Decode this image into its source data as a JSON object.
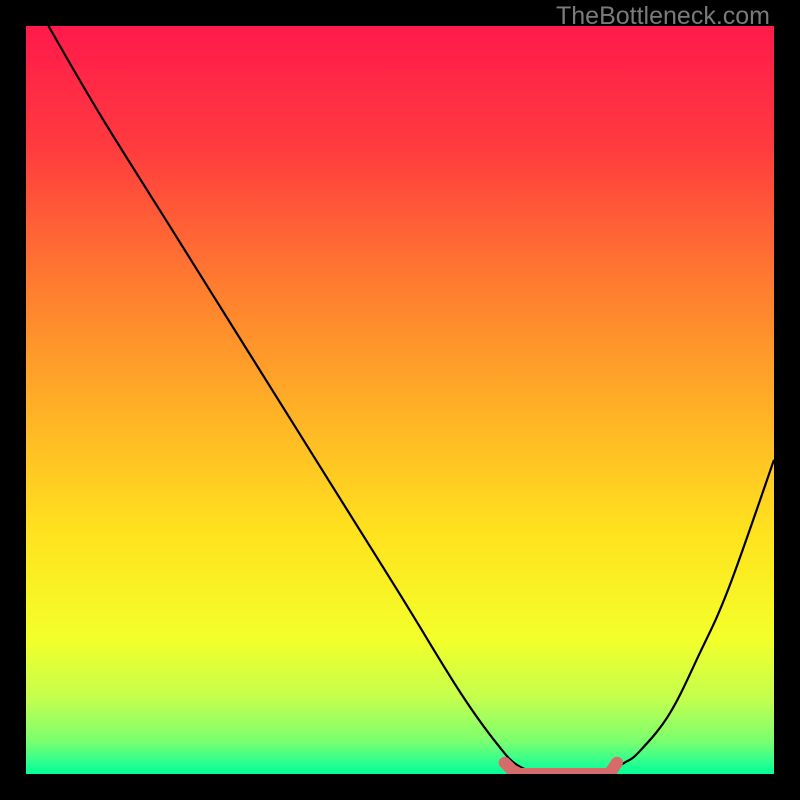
{
  "watermark": "TheBottleneck.com",
  "chart_data": {
    "type": "line",
    "title": "",
    "xlabel": "",
    "ylabel": "",
    "xlim": [
      0,
      100
    ],
    "ylim": [
      0,
      100
    ],
    "grid": false,
    "legend": false,
    "series": [
      {
        "name": "bottleneck-curve",
        "type": "line",
        "color": "#000000",
        "x": [
          3,
          10,
          20,
          30,
          40,
          50,
          58,
          63,
          66,
          70,
          74,
          78,
          80,
          82,
          86,
          90,
          94,
          100
        ],
        "y": [
          100,
          88,
          72,
          56,
          40,
          24,
          11,
          4,
          1,
          0,
          0,
          0.5,
          1.5,
          3,
          8,
          16,
          25,
          42
        ]
      },
      {
        "name": "optimal-flat-region",
        "type": "line",
        "color": "#d76a6a",
        "stroke_width": 12,
        "linecap": "round",
        "x": [
          64,
          65,
          66,
          70,
          74,
          78,
          79
        ],
        "y": [
          1.5,
          0.5,
          0,
          0,
          0,
          0,
          1.5
        ]
      }
    ],
    "background_gradient": {
      "stops": [
        {
          "offset": 0.0,
          "color": "#ff1a4b"
        },
        {
          "offset": 0.16,
          "color": "#ff3a3f"
        },
        {
          "offset": 0.34,
          "color": "#ff7a30"
        },
        {
          "offset": 0.52,
          "color": "#ffb326"
        },
        {
          "offset": 0.68,
          "color": "#ffe31e"
        },
        {
          "offset": 0.82,
          "color": "#f3ff2a"
        },
        {
          "offset": 0.9,
          "color": "#c2ff4e"
        },
        {
          "offset": 0.955,
          "color": "#7dff6e"
        },
        {
          "offset": 0.985,
          "color": "#2bff8f"
        },
        {
          "offset": 1.0,
          "color": "#00ff99"
        }
      ]
    }
  }
}
